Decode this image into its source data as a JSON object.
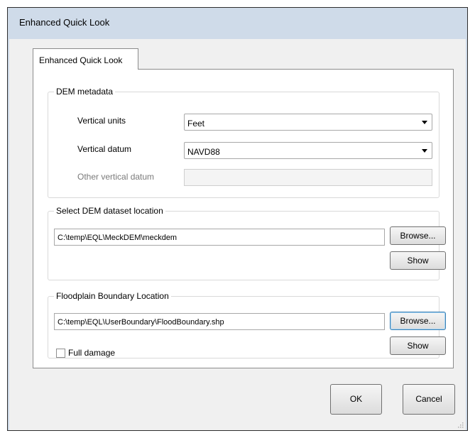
{
  "window": {
    "title": "Enhanced Quick Look"
  },
  "tab": {
    "label": "Enhanced Quick Look"
  },
  "dem_metadata": {
    "title": "DEM metadata",
    "vertical_units": {
      "label": "Vertical units",
      "value": "Feet"
    },
    "vertical_datum": {
      "label": "Vertical datum",
      "value": "NAVD88"
    },
    "other_datum": {
      "label": "Other vertical datum",
      "value": ""
    }
  },
  "dem_location": {
    "title": "Select DEM dataset location",
    "path": "C:\\temp\\EQL\\MeckDEM\\meckdem",
    "browse_label": "Browse...",
    "show_label": "Show"
  },
  "floodplain": {
    "title": "Floodplain Boundary Location",
    "path": "C:\\temp\\EQL\\UserBoundary\\FloodBoundary.shp",
    "browse_label": "Browse...",
    "show_label": "Show",
    "full_damage_label": "Full damage",
    "full_damage_checked": false
  },
  "footer": {
    "ok_label": "OK",
    "cancel_label": "Cancel"
  }
}
